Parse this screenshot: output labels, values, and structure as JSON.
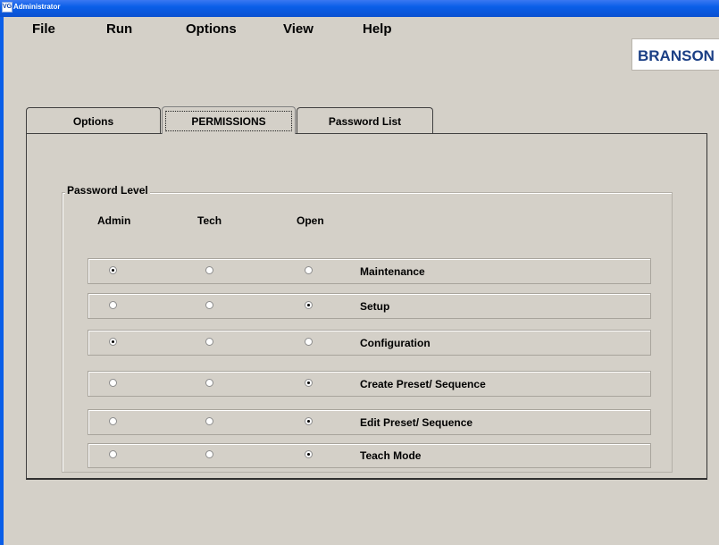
{
  "window": {
    "title": "Administrator",
    "icon_text": "VG"
  },
  "menu": {
    "items": [
      "File",
      "Run",
      "Options",
      "View",
      "Help"
    ]
  },
  "logo": {
    "text": "BRANSON"
  },
  "tabs": [
    {
      "label": "Options",
      "active": false
    },
    {
      "label": "PERMISSIONS",
      "active": true
    },
    {
      "label": "Password List",
      "active": false
    }
  ],
  "group": {
    "label": "Password Level",
    "columns": [
      "Admin",
      "Tech",
      "Open"
    ],
    "rows": [
      {
        "label": "Maintenance",
        "selected": "Admin"
      },
      {
        "label": "Setup",
        "selected": "Open"
      },
      {
        "label": "Configuration",
        "selected": "Admin"
      },
      {
        "label": "Create Preset/ Sequence",
        "selected": "Open"
      },
      {
        "label": "Edit Preset/ Sequence",
        "selected": "Open"
      },
      {
        "label": "Teach Mode",
        "selected": "Open"
      }
    ]
  }
}
